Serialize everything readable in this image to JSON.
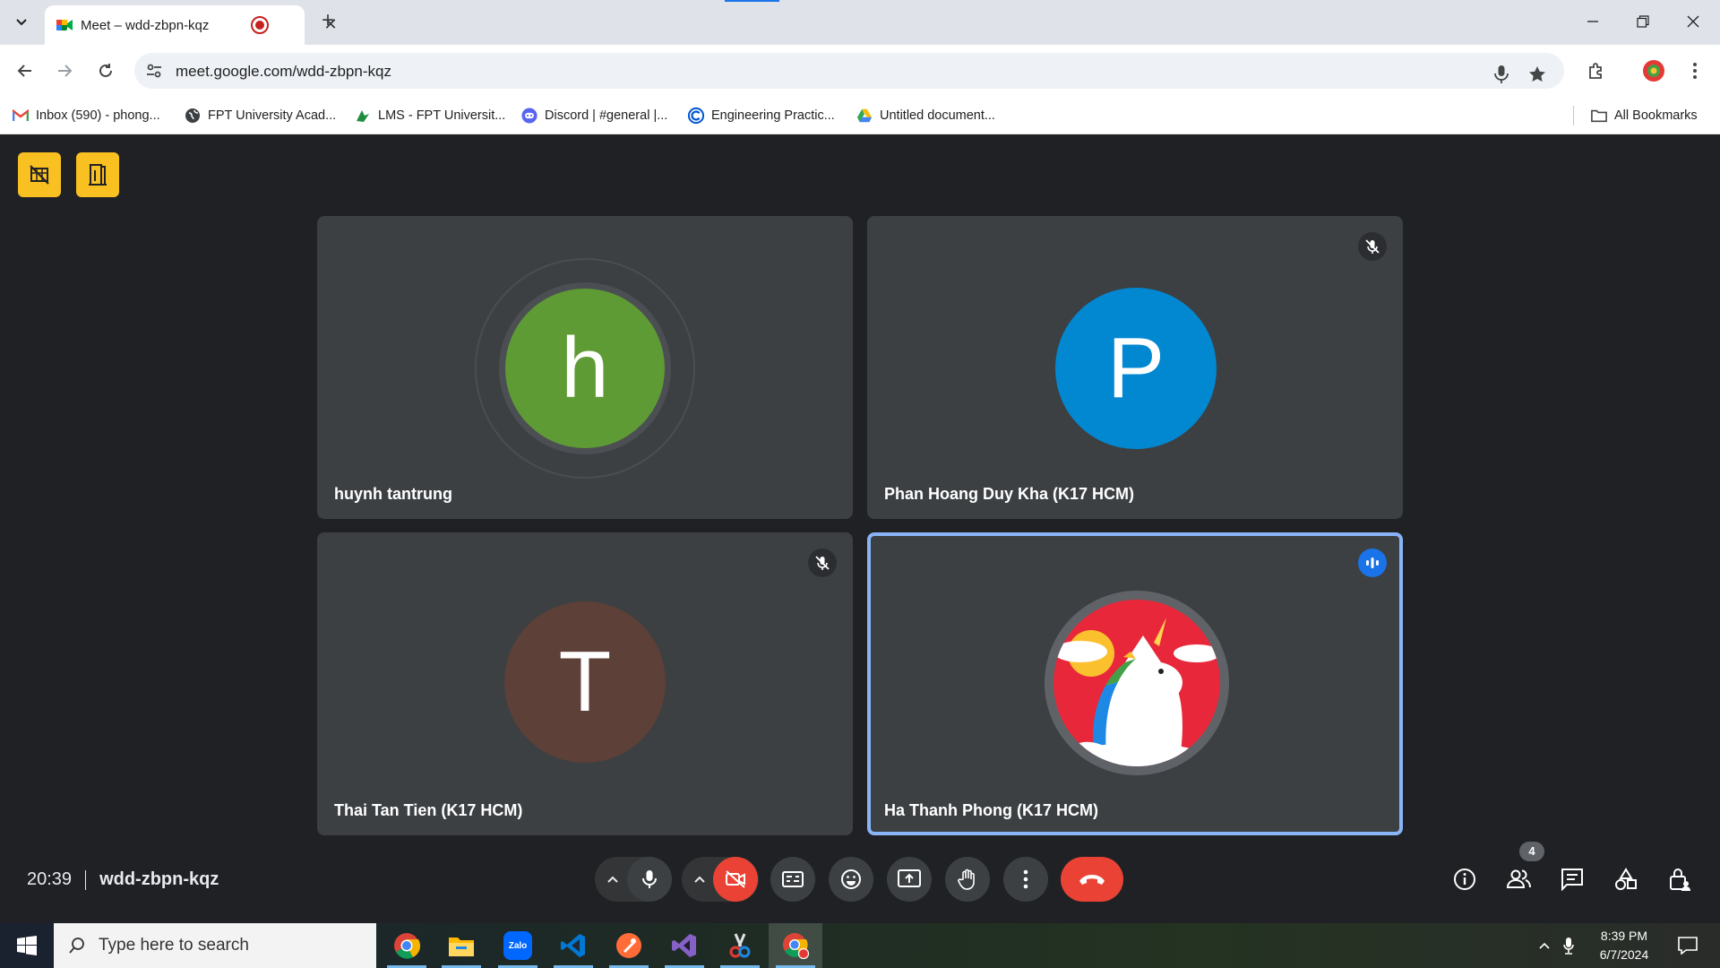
{
  "browser": {
    "tab": {
      "title": "Meet – wdd-zbpn-kqz"
    },
    "url": "meet.google.com/wdd-zbpn-kqz",
    "bookmarks": [
      {
        "label": "Inbox (590) - phong...",
        "icon": "gmail-icon"
      },
      {
        "label": "FPT University Acad...",
        "icon": "globe-icon"
      },
      {
        "label": "LMS - FPT Universit...",
        "icon": "lms-icon"
      },
      {
        "label": "Discord | #general |...",
        "icon": "discord-icon"
      },
      {
        "label": "Engineering Practic...",
        "icon": "coursera-icon"
      },
      {
        "label": "Untitled document...",
        "icon": "drive-icon"
      }
    ],
    "all_bookmarks": "All Bookmarks",
    "colors": {
      "tabstrip": "#dfe3e9",
      "omnibox": "#eef1f6"
    }
  },
  "meet": {
    "participants": [
      {
        "name": "huynh tantrung",
        "initial": "h",
        "color": "#5f9b34",
        "muted": false,
        "speaking_ring": true
      },
      {
        "name": "Phan Hoang Duy Kha (K17 HCM)",
        "initial": "P",
        "color": "#0288d1",
        "muted": true
      },
      {
        "name": "Thai Tan Tien (K17 HCM)",
        "initial": "T",
        "color": "#5d4037",
        "muted": true
      },
      {
        "name": "Ha Thanh Phong (K17 HCM)",
        "avatar": "unicorn-avatar",
        "active_speaker": true
      }
    ],
    "time": "20:39",
    "meeting_code": "wdd-zbpn-kqz",
    "people_count": "4",
    "colors": {
      "background": "#202124",
      "tile": "#3c4043",
      "end_call": "#ea4335",
      "badge": "#f9c021",
      "active_border": "#8ab4f8"
    }
  },
  "taskbar": {
    "search_placeholder": "Type here to search",
    "time": "8:39 PM",
    "date": "6/7/2024",
    "apps": [
      "chrome-icon",
      "file-explorer-icon",
      "zalo-icon",
      "vscode-icon",
      "postman-icon",
      "visual-studio-icon",
      "snipping-tool-icon",
      "chrome-profile-icon"
    ],
    "zalo_label": "Zalo"
  }
}
